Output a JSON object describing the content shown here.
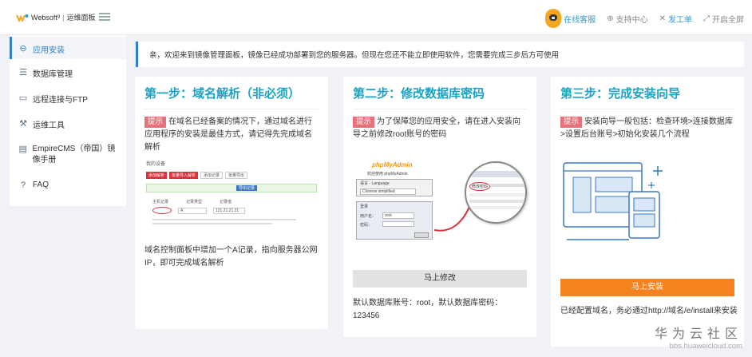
{
  "header": {
    "brand": "Websoft",
    "brand_sup": "9",
    "brand_sub": "运维面板",
    "actions": [
      {
        "label": "在线客服",
        "icon": "robot-icon"
      },
      {
        "label": "支持中心",
        "icon": "globe-icon"
      },
      {
        "label": "发工单",
        "icon": "ticket-icon"
      },
      {
        "label": "开启全屏",
        "icon": "fullscreen-icon"
      }
    ]
  },
  "sidebar": {
    "items": [
      {
        "label": "应用安装",
        "icon": "app-install-icon",
        "active": true
      },
      {
        "label": "数据库管理",
        "icon": "database-icon"
      },
      {
        "label": "远程连接与FTP",
        "icon": "monitor-icon"
      },
      {
        "label": "运维工具",
        "icon": "tools-icon"
      },
      {
        "label": "EmpireCMS（帝国）镜像手册",
        "icon": "manual-icon"
      },
      {
        "label": "FAQ",
        "icon": "question-icon"
      }
    ]
  },
  "notice": {
    "text": "亲，欢迎来到镜像管理面板，镜像已经成功部署到您的服务器。但现在您还不能立即使用软件，您需要完成三步后方可使用"
  },
  "steps": [
    {
      "title": "第一步：域名解析（非必须）",
      "tip_tag": "提示",
      "tip": "在域名已经备案的情况下，通过域名进行应用程序的安装是最佳方式，请记得先完成域名解析",
      "note": "域名控制面板中增加一个A记录，指向服务器公网IP，即可完成域名解析",
      "screenshot": {
        "title": "我的设备",
        "tabs": [
          "添加解析",
          "批量导入解析",
          "添加记录",
          "批量导出"
        ],
        "hint_button": "导出记录",
        "fields": [
          "主机记录",
          "记录类型",
          "记录值"
        ],
        "row_values": [
          "A",
          "121.21.21.21"
        ]
      }
    },
    {
      "title": "第二步：修改数据库密码",
      "tip_tag": "提示",
      "tip": "为了保障您的应用安全，请在进入安装向导之前修改root账号的密码",
      "button": "马上修改",
      "note": "默认数据库账号：root，默认数据库密码：123456",
      "screenshot": {
        "logo": "phpMyAdmin",
        "welcome": "欢迎使用 phpMyAdmin",
        "lang_label": "语言 - Language",
        "lang_value": "Chinese simplified",
        "login_label": "登录",
        "user_label": "用户名：",
        "user_value": "root",
        "pass_label": "密码：",
        "zoom_label": "修改密码"
      }
    },
    {
      "title": "第三步：完成安装向导",
      "tip_tag": "提示",
      "tip": "安装向导一般包括：检查环境>连接数据库>设置后台账号>初始化安装几个流程",
      "button": "马上安装",
      "note": "已经配置域名，务必通过http://域名/e/install来安装"
    }
  ],
  "watermark": {
    "line1": "华为云社区",
    "line2": "bbs.huaweicloud.com"
  },
  "colors": {
    "accent": "#2f80c8",
    "title": "#1aa3c5",
    "tag": "#e8707a",
    "orange": "#f5811f"
  }
}
